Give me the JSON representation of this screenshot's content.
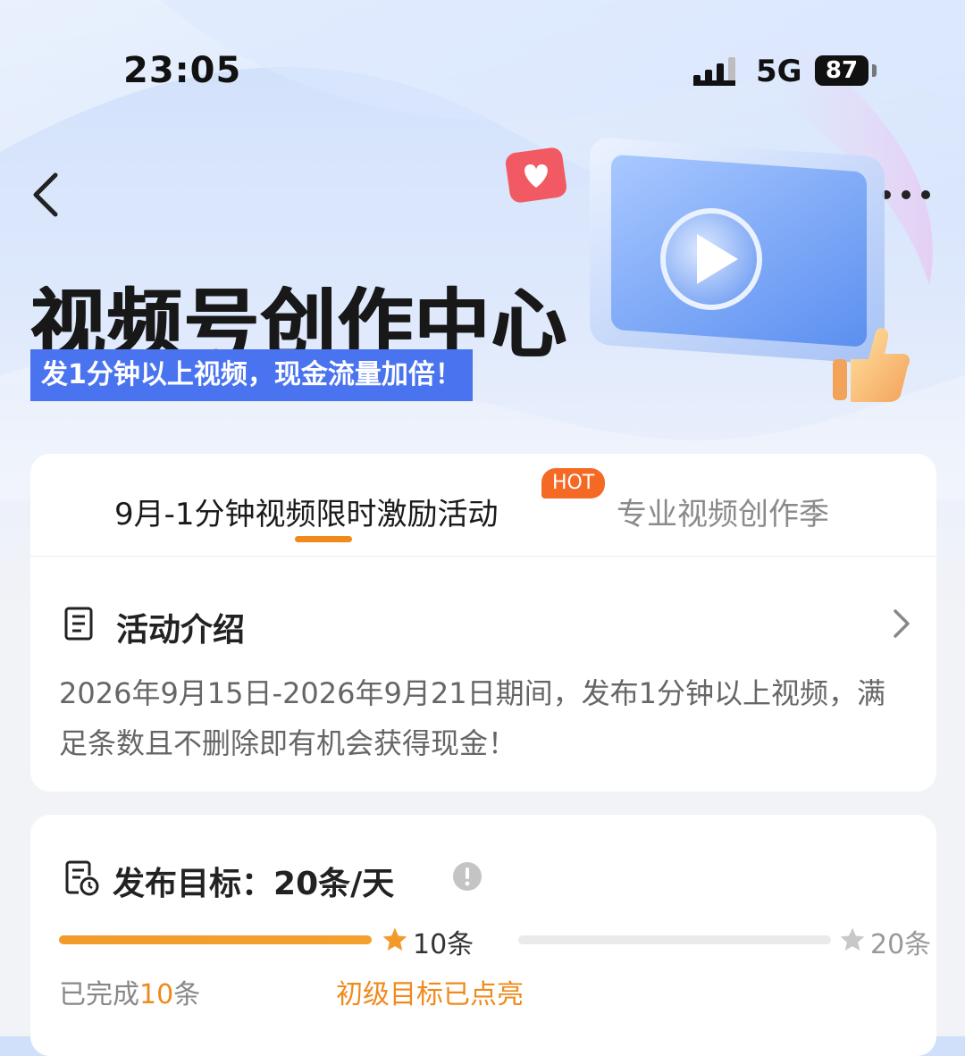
{
  "status_bar": {
    "time": "23:05",
    "network": "5G",
    "battery": "87"
  },
  "hero": {
    "title": "视频号创作中心",
    "subtitle": "发1分钟以上视频，现金流量加倍！"
  },
  "tabs": [
    {
      "label": "9月-1分钟视频限时激励活动",
      "active": true,
      "badge": "HOT"
    },
    {
      "label": "专业视频创作季",
      "active": false
    }
  ],
  "intro": {
    "heading": "活动介绍",
    "body": "2026年9月15日-2026年9月21日期间，发布1分钟以上视频，满足条数且不删除即有机会获得现金！"
  },
  "target": {
    "heading": "发布目标：",
    "goal": "20条/天",
    "progress_fraction": 0.5,
    "milestones": [
      {
        "label": "10条",
        "reached": true
      },
      {
        "label": "20条",
        "reached": false
      }
    ],
    "completed_prefix": "已完成",
    "completed_count": "10",
    "completed_suffix": "条",
    "level_status": "初级目标已点亮"
  },
  "colors": {
    "accent": "#f08a1c",
    "hot": "#f46a24",
    "subtitle_bg": "#4a73f0",
    "muted_star": "#c8c8c8"
  },
  "icons": [
    "back-arrow-icon",
    "more-dots-icon",
    "document-icon",
    "chevron-right-icon",
    "target-calendar-icon",
    "info-icon",
    "star-icon"
  ]
}
